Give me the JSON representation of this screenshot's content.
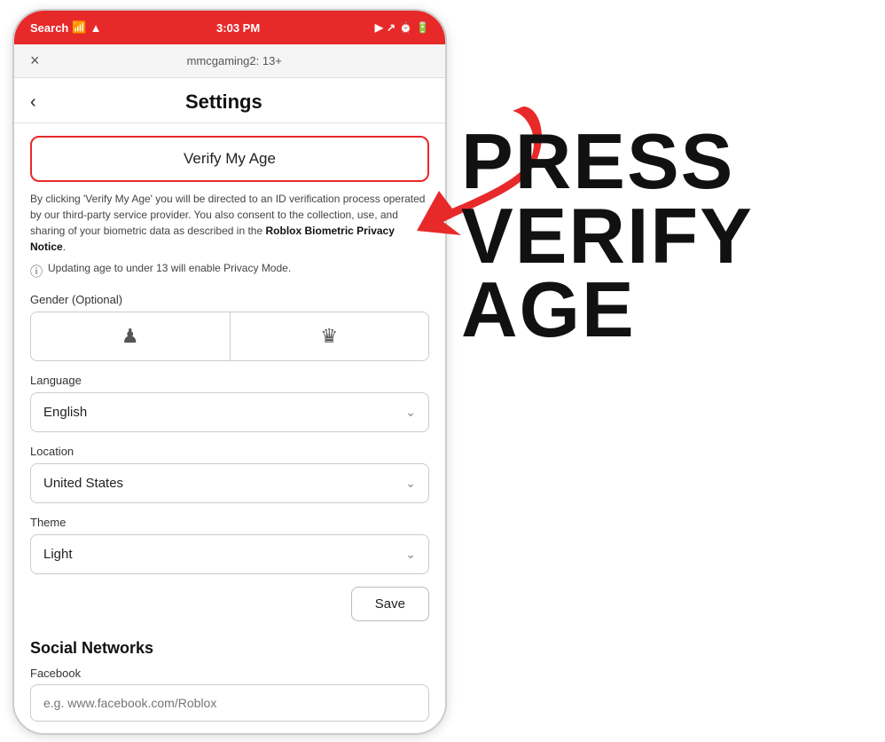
{
  "statusBar": {
    "carrier": "Search",
    "time": "3:03 PM",
    "batteryIcons": "◉ ▶ 🔋"
  },
  "browserBar": {
    "closeLabel": "×",
    "urlText": "mmcgaming2: 13+"
  },
  "header": {
    "backLabel": "‹",
    "title": "Settings"
  },
  "verifyButton": {
    "label": "Verify My Age"
  },
  "consentText": "By clicking 'Verify My Age' you will be directed to an ID verification process operated by our third-party service provider. You also consent to the collection, use, and sharing of your biometric data as described in the",
  "privacyLinkText": "Roblox Biometric Privacy Notice",
  "privacyNote": "Updating age to under 13 will enable Privacy Mode.",
  "gender": {
    "label": "Gender (Optional)",
    "maleIcon": "♟",
    "femaleIcon": "♛"
  },
  "language": {
    "label": "Language",
    "selected": "English"
  },
  "location": {
    "label": "Location",
    "selected": "United States"
  },
  "theme": {
    "label": "Theme",
    "selected": "Light"
  },
  "saveButton": {
    "label": "Save"
  },
  "socialNetworks": {
    "title": "Social Networks",
    "facebookLabel": "Facebook",
    "facebookPlaceholder": "e.g. www.facebook.com/Roblox"
  },
  "pressVerify": {
    "line1": "PRESS",
    "line2": "VERIFY",
    "line3": "AGE"
  }
}
